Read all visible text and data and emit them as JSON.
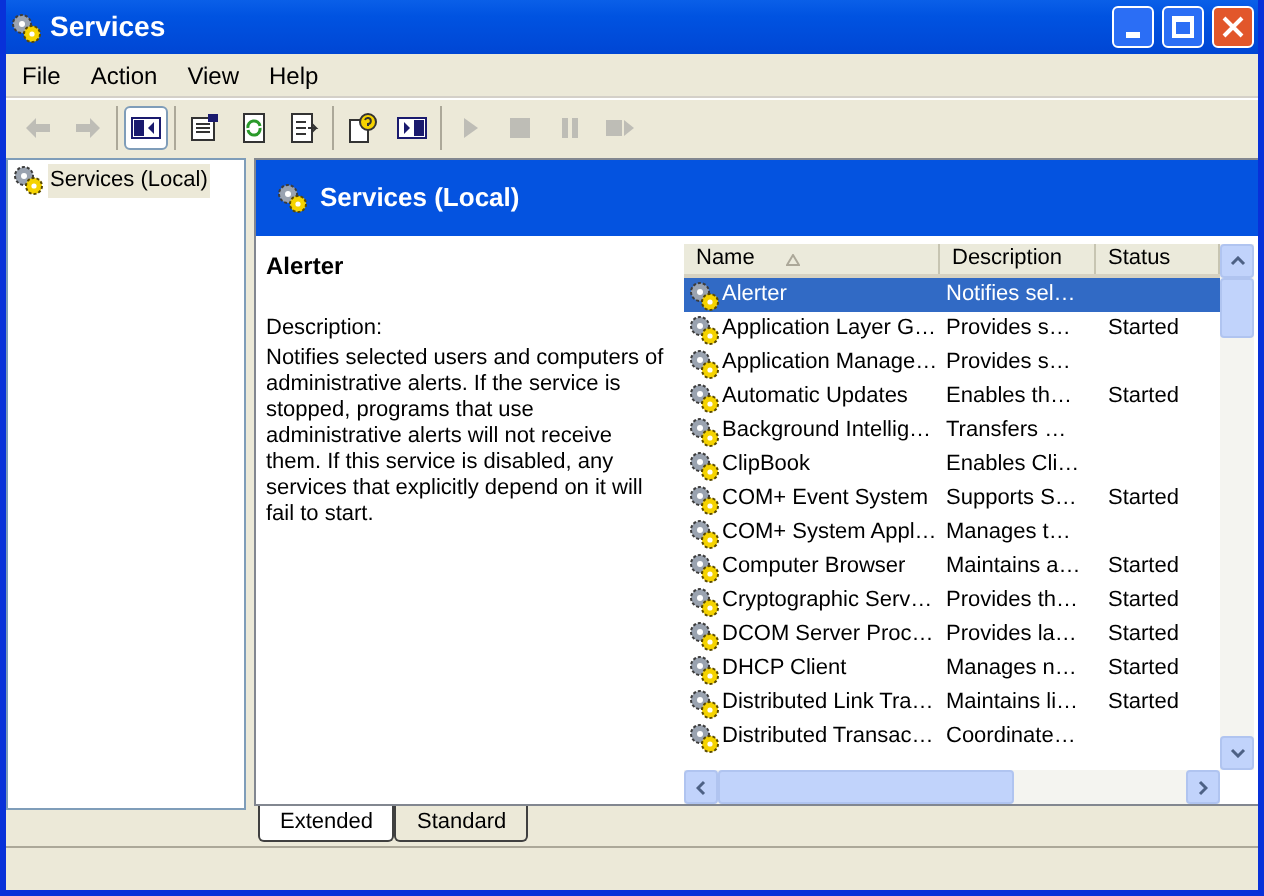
{
  "window": {
    "title": "Services"
  },
  "menu": [
    "File",
    "Action",
    "View",
    "Help"
  ],
  "toolbar": [
    [
      {
        "kind": "back",
        "disabled": true,
        "pressed": false
      },
      {
        "kind": "forward",
        "disabled": true,
        "pressed": false
      }
    ],
    [
      {
        "kind": "tree",
        "disabled": false,
        "pressed": true
      }
    ],
    [
      {
        "kind": "properties",
        "disabled": false,
        "pressed": false
      },
      {
        "kind": "refresh",
        "disabled": false,
        "pressed": false
      },
      {
        "kind": "export",
        "disabled": false,
        "pressed": false
      }
    ],
    [
      {
        "kind": "help",
        "disabled": false,
        "pressed": false
      },
      {
        "kind": "pane",
        "disabled": false,
        "pressed": false
      }
    ],
    [
      {
        "kind": "start",
        "disabled": true,
        "pressed": false
      },
      {
        "kind": "stop",
        "disabled": true,
        "pressed": false
      },
      {
        "kind": "pause",
        "disabled": true,
        "pressed": false
      },
      {
        "kind": "restart",
        "disabled": true,
        "pressed": false
      }
    ]
  ],
  "tree": [
    {
      "label": "Services (Local)",
      "selected": true
    }
  ],
  "header": {
    "title": "Services (Local)"
  },
  "details": {
    "name": "Alerter",
    "description_label": "Description:",
    "description": "Notifies selected users and computers of administrative alerts. If the service is stopped, programs that use administrative alerts will not receive them. If this service is disabled, any services that explicitly depend on it will fail to start."
  },
  "table": {
    "columns": [
      "Name",
      "Description",
      "Status"
    ],
    "rows": [
      {
        "name": "Alerter",
        "description": "Notifies sel…",
        "selected": true
      },
      {
        "name": "Application Layer G…",
        "description": "Provides s…",
        "status": "Started",
        "selected": false
      },
      {
        "name": "Application Manage…",
        "description": "Provides s…",
        "selected": false
      },
      {
        "name": "Automatic Updates",
        "description": "Enables th…",
        "status": "Started",
        "selected": false
      },
      {
        "name": "Background Intellig…",
        "description": "Transfers …",
        "selected": false
      },
      {
        "name": "ClipBook",
        "description": "Enables Cli…",
        "selected": false
      },
      {
        "name": "COM+ Event System",
        "description": "Supports S…",
        "status": "Started",
        "selected": false
      },
      {
        "name": "COM+ System Appl…",
        "description": "Manages t…",
        "selected": false
      },
      {
        "name": "Computer Browser",
        "description": "Maintains a…",
        "status": "Started",
        "selected": false
      },
      {
        "name": "Cryptographic Serv…",
        "description": "Provides th…",
        "status": "Started",
        "selected": false
      },
      {
        "name": "DCOM Server Proc…",
        "description": "Provides la…",
        "status": "Started",
        "selected": false
      },
      {
        "name": "DHCP Client",
        "description": "Manages n…",
        "status": "Started",
        "selected": false
      },
      {
        "name": "Distributed Link Tra…",
        "description": "Maintains li…",
        "status": "Started",
        "selected": false
      },
      {
        "name": "Distributed Transac…",
        "description": "Coordinate…",
        "selected": false
      }
    ]
  },
  "tabs": [
    {
      "label": "Extended",
      "selected": true
    },
    {
      "label": "Standard",
      "selected": false
    }
  ]
}
